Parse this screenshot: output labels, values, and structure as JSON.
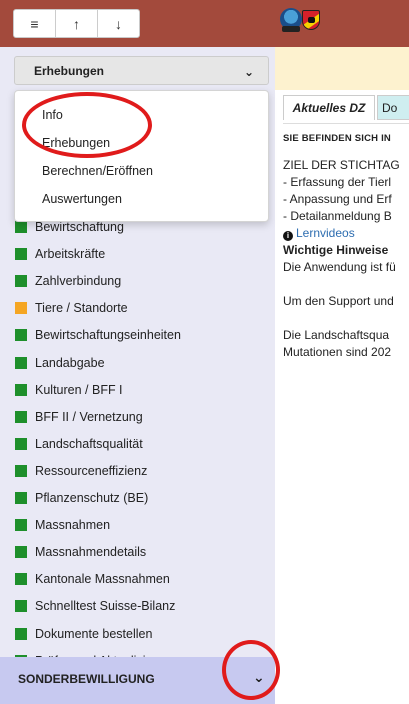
{
  "toolbar": {
    "menu_icon": "hamburger-icon",
    "up_icon": "arrow-up-icon",
    "down_icon": "arrow-down-icon",
    "menu_glyph": "≡",
    "up_glyph": "↑",
    "down_glyph": "↓"
  },
  "colors": {
    "topbar": "#a34a3c",
    "subbar": "#fdf2cf",
    "sidebar": "#e9e9f5",
    "green": "#1e8f2b",
    "orange": "#f5a623",
    "sonder_bg": "#c7c9f0",
    "annotation": "#e01b1b"
  },
  "select": {
    "value": "Erhebungen",
    "chevron": "⌄"
  },
  "dropdown": {
    "items": [
      "Info",
      "Erhebungen",
      "Berechnen/Eröffnen",
      "Auswertungen"
    ]
  },
  "sidebar": {
    "items": [
      {
        "label": "Bewirtschaftung",
        "status": "green"
      },
      {
        "label": "Arbeitskräfte",
        "status": "green"
      },
      {
        "label": "Zahlverbindung",
        "status": "green"
      },
      {
        "label": "Tiere / Standorte",
        "status": "orange"
      },
      {
        "label": "Bewirtschaftungseinheiten",
        "status": "green"
      },
      {
        "label": "Landabgabe",
        "status": "green"
      },
      {
        "label": "Kulturen / BFF I",
        "status": "green"
      },
      {
        "label": "BFF II / Vernetzung",
        "status": "green"
      },
      {
        "label": "Landschaftsqualität",
        "status": "green"
      },
      {
        "label": "Ressourceneffizienz",
        "status": "green"
      },
      {
        "label": "Pflanzenschutz (BE)",
        "status": "green"
      },
      {
        "label": "Massnahmen",
        "status": "green"
      },
      {
        "label": "Massnahmendetails",
        "status": "green"
      },
      {
        "label": "Kantonale Massnahmen",
        "status": "green"
      },
      {
        "label": "Schnelltest Suisse-Bilanz",
        "status": "green"
      },
      {
        "label": "Dokumente bestellen",
        "status": "green"
      },
      {
        "label": "Prüfen und Aktualisieren",
        "status": "green"
      }
    ],
    "sonder_label": "SONDERBEWILLIGUNG",
    "sonder_chevron": "⌄"
  },
  "tabs": {
    "active": "Aktuelles DZ",
    "other": "Do"
  },
  "content": {
    "heading": "SIE BEFINDEN SICH IN",
    "lines": [
      "ZIEL DER STICHTAG",
      "- Erfassung der Tierl",
      "- Anpassung und Erf",
      "- Detailanmeldung B"
    ],
    "link": "Lernvideos",
    "bold_line": "Wichtige Hinweise",
    "para1": "Die Anwendung ist fü",
    "para2": "Um den Support und",
    "para3a": "Die Landschaftsqua",
    "para3b": "Mutationen sind 202"
  }
}
